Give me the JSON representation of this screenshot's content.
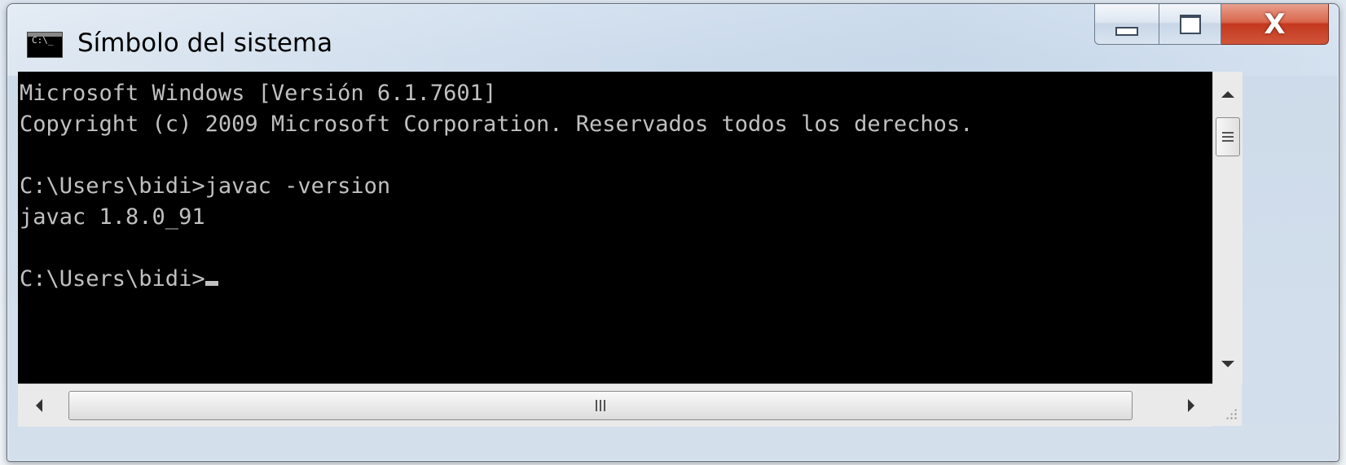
{
  "window": {
    "title": "Símbolo del sistema",
    "icon": "console-icon"
  },
  "caption_buttons": {
    "minimize_icon": "minimize-icon",
    "maximize_icon": "maximize-icon",
    "close_icon": "close-icon"
  },
  "console": {
    "lines": [
      "Microsoft Windows [Versión 6.1.7601]",
      "Copyright (c) 2009 Microsoft Corporation. Reservados todos los derechos.",
      "",
      "C:\\Users\\bidi>javac -version",
      "javac 1.8.0_91",
      "",
      "C:\\Users\\bidi>"
    ],
    "text_color": "#c0c0c0",
    "background_color": "#000000"
  },
  "colors": {
    "close_button": "#c4381e",
    "frame": "#cddbea"
  }
}
